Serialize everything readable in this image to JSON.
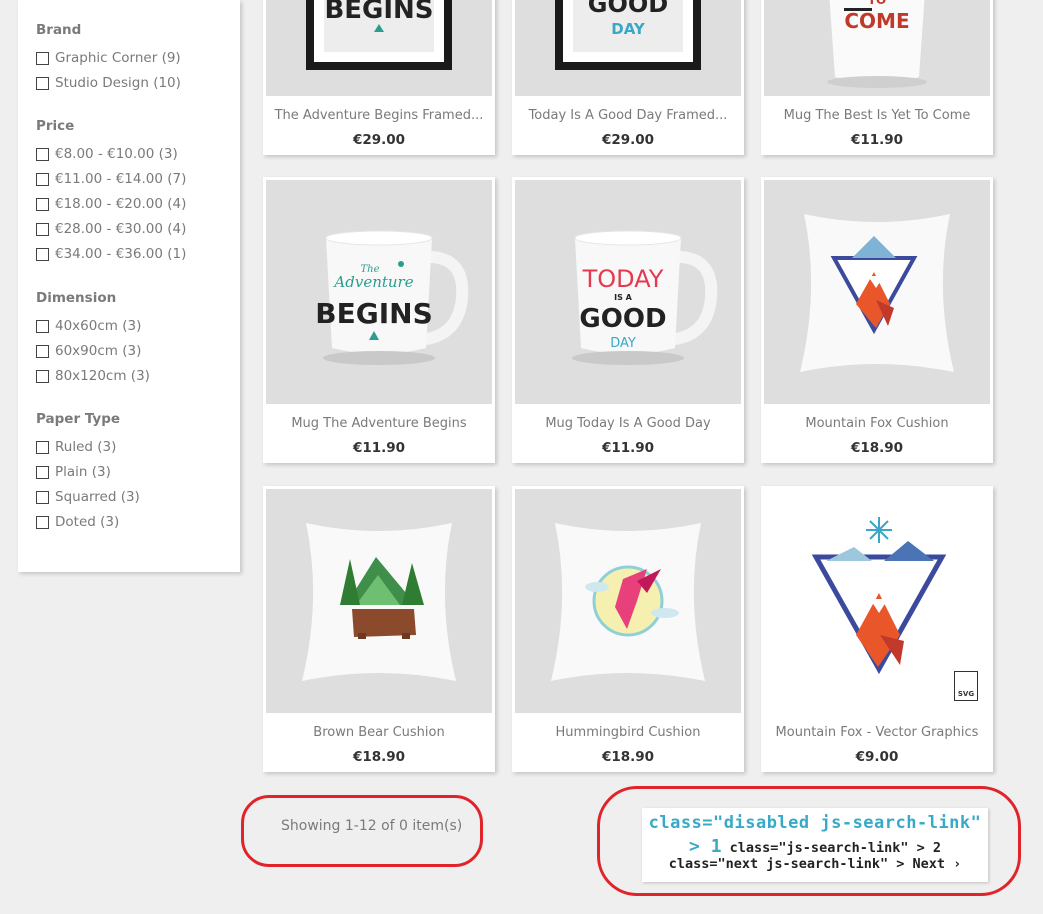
{
  "filters": [
    {
      "title": "Brand",
      "options": [
        "Graphic Corner (9)",
        "Studio Design (10)"
      ]
    },
    {
      "title": "Price",
      "options": [
        "€8.00 - €10.00 (3)",
        "€11.00 - €14.00 (7)",
        "€18.00 - €20.00 (4)",
        "€28.00 - €30.00 (4)",
        "€34.00 - €36.00 (1)"
      ]
    },
    {
      "title": "Dimension",
      "options": [
        "40x60cm (3)",
        "60x90cm (3)",
        "80x120cm (3)"
      ]
    },
    {
      "title": "Paper Type",
      "options": [
        "Ruled (3)",
        "Plain (3)",
        "Squarred (3)",
        "Doted (3)"
      ]
    }
  ],
  "products": [
    {
      "name": "The Adventure Begins Framed...",
      "price": "€29.00",
      "image": "framed-poster-adventure-begins"
    },
    {
      "name": "Today Is A Good Day Framed...",
      "price": "€29.00",
      "image": "framed-poster-good-day"
    },
    {
      "name": "Mug The Best Is Yet To Come",
      "price": "€11.90",
      "image": "mug-best-is-yet-to-come"
    },
    {
      "name": "Mug The Adventure Begins",
      "price": "€11.90",
      "image": "mug-adventure-begins"
    },
    {
      "name": "Mug Today Is A Good Day",
      "price": "€11.90",
      "image": "mug-good-day"
    },
    {
      "name": "Mountain Fox Cushion",
      "price": "€18.90",
      "image": "cushion-mountain-fox"
    },
    {
      "name": "Brown Bear Cushion",
      "price": "€18.90",
      "image": "cushion-brown-bear"
    },
    {
      "name": "Hummingbird Cushion",
      "price": "€18.90",
      "image": "cushion-hummingbird"
    },
    {
      "name": "Mountain Fox - Vector Graphics",
      "price": "€9.00",
      "image": "vector-mountain-fox"
    }
  ],
  "poster_texts": {
    "begins": "BEGINS",
    "good_day": "GOOD",
    "day": "DAY",
    "come": "COME",
    "to": "TO"
  },
  "mug_texts": {
    "adventure": {
      "the": "The",
      "script": "Adventure",
      "big": "BEGINS"
    },
    "today": {
      "top": "TODAY",
      "isa": "IS A",
      "good": "GOOD",
      "day": "DAY"
    }
  },
  "svg_badge": "SVG",
  "pagination": {
    "showing": "Showing 1-12 of 0 item(s)",
    "annotation_line1": "class=\"disabled js-search-link\"",
    "annotation_line2_page1": "> 1",
    "annotation_line2_rest": " class=\"js-search-link\" > 2",
    "annotation_line3": "class=\"next js-search-link\" > Next ›"
  },
  "colors": {
    "annotation_blue": "#38a9c6",
    "highlight_red": "#e0242a",
    "page_bg": "#efefef"
  }
}
